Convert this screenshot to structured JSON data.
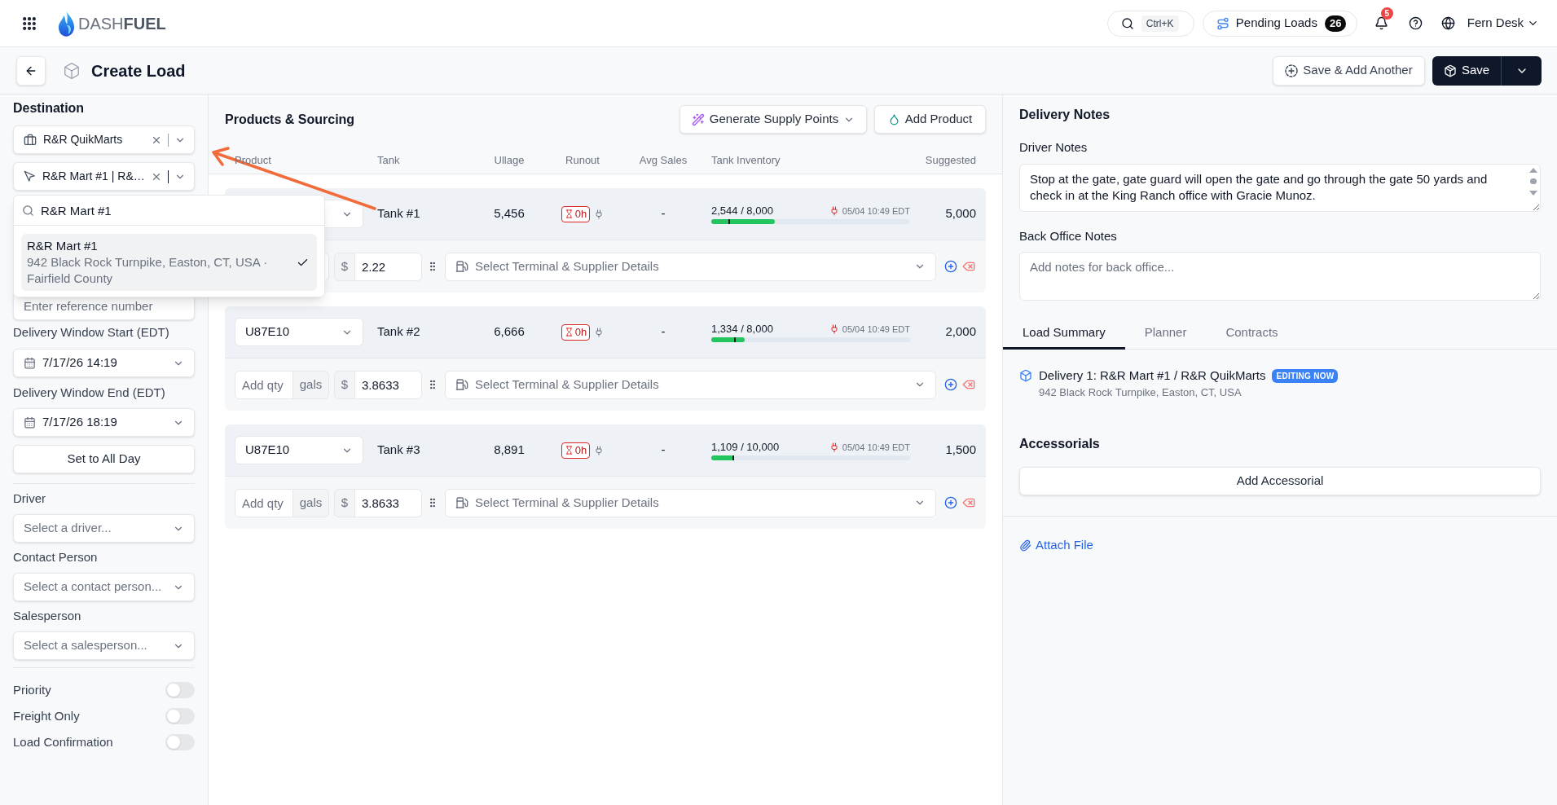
{
  "topbar": {
    "logo": "DASH**FUEL**",
    "search_shortcut": "Ctrl+K",
    "pending_loads": {
      "label": "Pending Loads",
      "count": "26"
    },
    "notification_count": "5",
    "user": "Fern Desk"
  },
  "page_header": {
    "title": "Create Load",
    "actions": [
      {
        "kind": "secondary",
        "label": "Save & Add Another"
      },
      {
        "kind": "primary",
        "label": "Save"
      }
    ]
  },
  "sidebar": {
    "title": "Destination",
    "customer": {
      "value": "R&R QuikMarts"
    },
    "site": {
      "value": "R&R Mart #1 | R&…"
    },
    "site_dropdown": {
      "search": "R&R Mart #1",
      "options": [
        {
          "name": "R&R Mart #1",
          "address": "942 Black Rock Turnpike, Easton, CT, USA · Fairfield County",
          "selected": true
        }
      ]
    },
    "reference": {
      "placeholder": "Enter reference number"
    },
    "delivery_window": [
      {
        "label": "Delivery Window Start (EDT)",
        "value": "7/17/26 14:19"
      },
      {
        "label": "Delivery Window End (EDT)",
        "value": "7/17/26 18:19"
      }
    ],
    "all_day_button": "Set to All Day",
    "selects": [
      {
        "label": "Driver",
        "placeholder": "Select a driver..."
      },
      {
        "label": "Contact Person",
        "placeholder": "Select a contact person..."
      },
      {
        "label": "Salesperson",
        "placeholder": "Select a salesperson..."
      }
    ],
    "toggles": [
      {
        "label": "Priority",
        "on": false
      },
      {
        "label": "Freight Only",
        "on": false
      },
      {
        "label": "Load Confirmation",
        "on": false
      }
    ]
  },
  "products": {
    "title": "Products & Sourcing",
    "actions": [
      {
        "kind": "menu",
        "label": "Generate Supply Points"
      },
      {
        "kind": "add",
        "label": "Add Product"
      }
    ],
    "columns": [
      "Product",
      "Tank",
      "Ullage",
      "Runout",
      "Avg Sales",
      "Tank Inventory",
      "Suggested"
    ],
    "rows": [
      {
        "tank": "Tank #1",
        "ullage": "5,456",
        "runout": "0h",
        "avg_sales": "-",
        "inventory": {
          "reading": "2,544 / 8,000",
          "level": 0.318,
          "marker": {
            "level": 0.086
          },
          "updated": "05/04 10:49 EDT"
        },
        "suggested": "5,000",
        "sourcing": {
          "currency": "$",
          "price": "2.22",
          "terminal_placeholder": "Select Terminal & Supplier Details"
        }
      },
      {
        "product": "U87E10",
        "tank": "Tank #2",
        "ullage": "6,666",
        "runout": "0h",
        "avg_sales": "-",
        "inventory": {
          "reading": "1,334 / 8,000",
          "level": 0.167,
          "marker": {
            "level": 0.115
          },
          "updated": "05/04 10:49 EDT"
        },
        "suggested": "2,000",
        "sourcing": {
          "qty_placeholder": "Add qty",
          "unit": "gals",
          "currency": "$",
          "price": "3.8633",
          "terminal_placeholder": "Select Terminal & Supplier Details"
        }
      },
      {
        "product": "U87E10",
        "tank": "Tank #3",
        "ullage": "8,891",
        "runout": "0h",
        "avg_sales": "-",
        "inventory": {
          "reading": "1,109 / 10,000",
          "level": 0.111,
          "marker": {
            "level": 0.105
          },
          "updated": "05/04 10:49 EDT"
        },
        "suggested": "1,500",
        "sourcing": {
          "qty_placeholder": "Add qty",
          "unit": "gals",
          "currency": "$",
          "price": "3.8633",
          "terminal_placeholder": "Select Terminal & Supplier Details"
        }
      }
    ]
  },
  "delivery_notes": {
    "title": "Delivery Notes",
    "driver_notes": {
      "label": "Driver Notes",
      "value": "Stop at the gate, gate guard will open the gate and go through the gate 50 yards and check in at the King Ranch office with Gracie Munoz."
    },
    "back_office_notes": {
      "label": "Back Office Notes",
      "placeholder": "Add notes for back office..."
    }
  },
  "tabs": [
    {
      "label": "Load Summary",
      "selected": true
    },
    {
      "label": "Planner",
      "selected": false
    },
    {
      "label": "Contracts",
      "selected": false
    }
  ],
  "load_summary": {
    "deliveries": [
      {
        "title": "Delivery 1: R&R Mart #1 / R&R QuikMarts",
        "badge": "EDITING NOW",
        "address": "942 Black Rock Turnpike, Easton, CT, USA"
      }
    ]
  },
  "accessorials": {
    "title": "Accessorials",
    "button": "Add Accessorial"
  },
  "attach_file": "Attach File"
}
